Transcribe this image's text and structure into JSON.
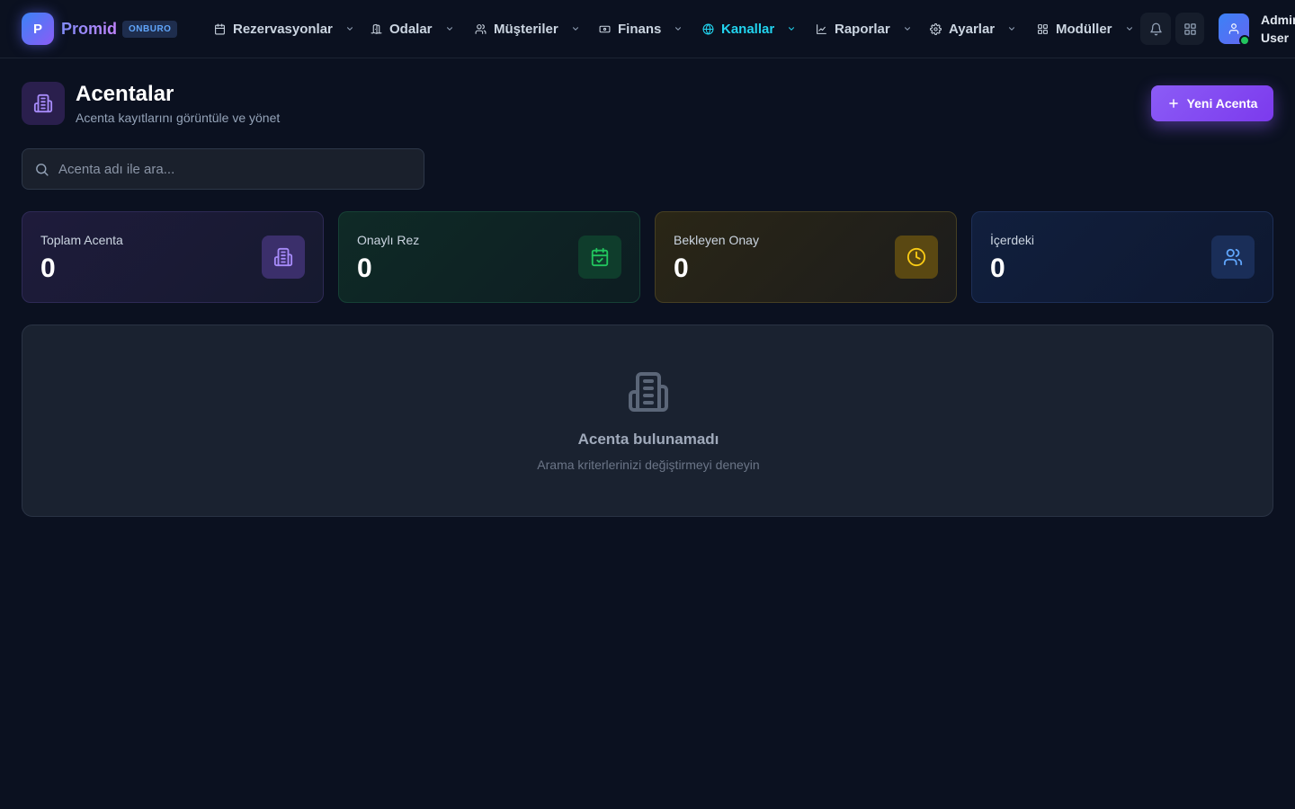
{
  "brand": {
    "logo_letter": "P",
    "name": "Promid",
    "badge": "ONBURO"
  },
  "nav": {
    "items": [
      {
        "label": "Rezervasyonlar",
        "icon": "calendar-icon"
      },
      {
        "label": "Odalar",
        "icon": "door-icon"
      },
      {
        "label": "Müşteriler",
        "icon": "users-icon"
      },
      {
        "label": "Finans",
        "icon": "banknote-icon"
      },
      {
        "label": "Kanallar",
        "icon": "globe-icon",
        "active": true
      },
      {
        "label": "Raporlar",
        "icon": "line-chart-icon"
      },
      {
        "label": "Ayarlar",
        "icon": "gear-icon"
      },
      {
        "label": "Modüller",
        "icon": "grid-icon"
      }
    ],
    "active_color": "#22d3ee"
  },
  "user": {
    "name": "Admin User"
  },
  "page": {
    "title": "Acentalar",
    "subtitle": "Acenta kayıtlarını görüntüle ve yönet",
    "new_button": "Yeni Acenta"
  },
  "search": {
    "placeholder": "Acenta adı ile ara...",
    "value": ""
  },
  "stats": [
    {
      "label": "Toplam Acenta",
      "value": "0",
      "icon": "building-icon",
      "color": "#a78bfa"
    },
    {
      "label": "Onaylı Rez",
      "value": "0",
      "icon": "calendar-check-icon",
      "color": "#22c55e"
    },
    {
      "label": "Bekleyen Onay",
      "value": "0",
      "icon": "clock-icon",
      "color": "#facc15"
    },
    {
      "label": "İçerdeki",
      "value": "0",
      "icon": "users-icon",
      "color": "#60a5fa"
    }
  ],
  "empty_state": {
    "title": "Acenta bulunamadı",
    "subtitle": "Arama kriterlerinizi değiştirmeyi deneyin",
    "icon": "building-icon"
  },
  "colors": {
    "background": "#0b1120",
    "accent": "#8b5cf6"
  }
}
